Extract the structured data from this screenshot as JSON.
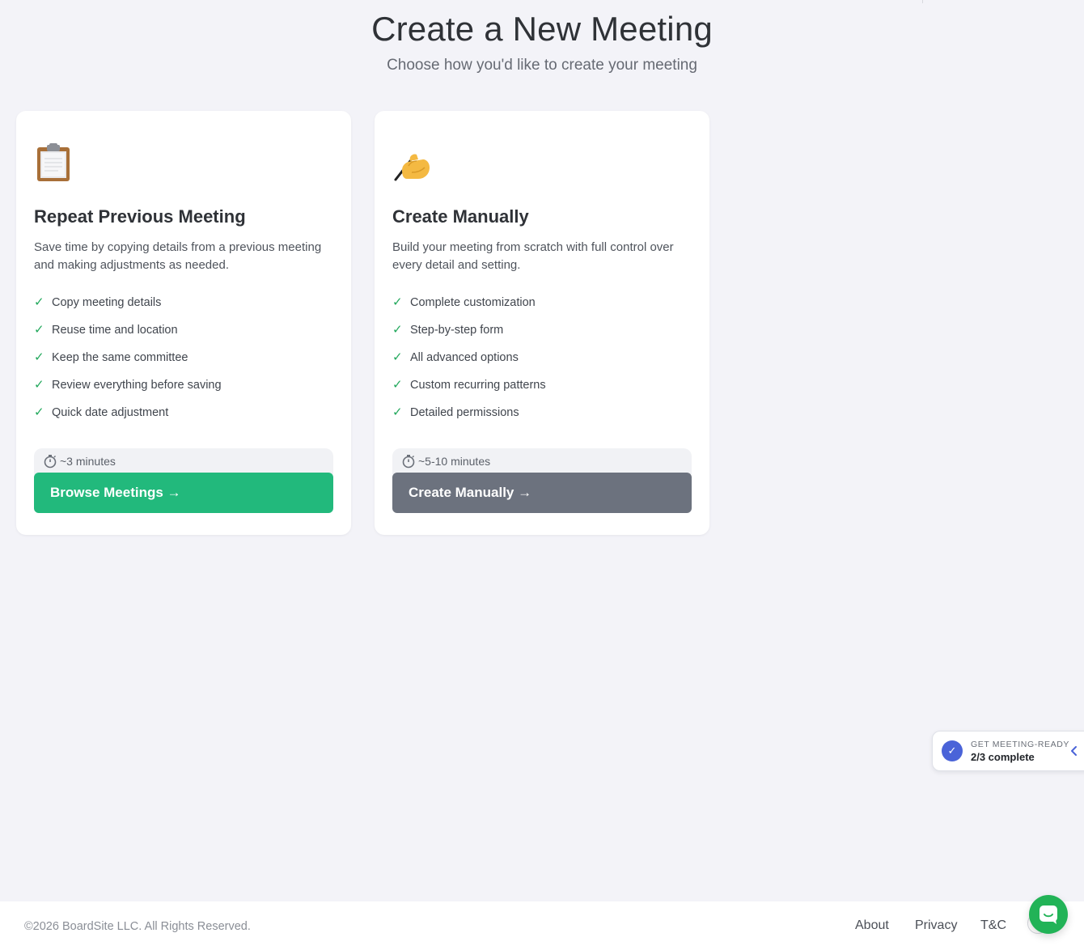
{
  "header": {
    "title": "Create a New Meeting",
    "subtitle": "Choose how you'd like to create your meeting"
  },
  "cards": [
    {
      "icon": "clipboard-icon",
      "title": "Repeat Previous Meeting",
      "description": "Save time by copying details from a previous meeting and making adjustments as needed.",
      "features": [
        "Copy meeting details",
        "Reuse time and location",
        "Keep the same committee",
        "Review everything before saving",
        "Quick date adjustment"
      ],
      "time": "~3 minutes",
      "button_label": "Browse Meetings →",
      "button_color": "#22b97c"
    },
    {
      "icon": "writing-hand-icon",
      "title": "Create Manually",
      "description": "Build your meeting from scratch with full control over every detail and setting.",
      "features": [
        "Complete customization",
        "Step-by-step form",
        "All advanced options",
        "Custom recurring patterns",
        "Detailed permissions"
      ],
      "time": "~5-10 minutes",
      "button_label": "Create Manually →",
      "button_color": "#6c727e"
    }
  ],
  "progress_widget": {
    "label": "GET MEETING-READY",
    "value": "2/3 complete",
    "accent_color": "#4a63d8"
  },
  "footer": {
    "copyright": "©2026 BoardSite LLC. All Rights Reserved.",
    "links": [
      "About",
      "Privacy",
      "T&C"
    ]
  },
  "chat": {
    "icon": "chat-icon",
    "color": "#22b357"
  }
}
